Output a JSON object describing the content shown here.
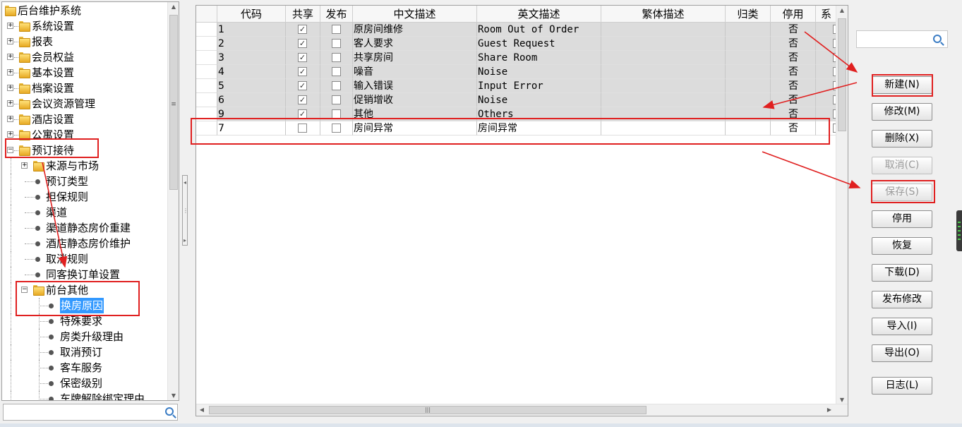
{
  "tree": {
    "items": [
      {
        "label": "后台维护系统",
        "kind": "root"
      },
      {
        "label": "系统设置",
        "kind": "folder",
        "toggle": "+"
      },
      {
        "label": "报表",
        "kind": "folder",
        "toggle": "+"
      },
      {
        "label": "会员权益",
        "kind": "folder",
        "toggle": "+"
      },
      {
        "label": "基本设置",
        "kind": "folder",
        "toggle": "+"
      },
      {
        "label": "档案设置",
        "kind": "folder",
        "toggle": "+"
      },
      {
        "label": "会议资源管理",
        "kind": "folder",
        "toggle": "+"
      },
      {
        "label": "酒店设置",
        "kind": "folder",
        "toggle": "+"
      },
      {
        "label": "公寓设置",
        "kind": "folder",
        "toggle": "+"
      },
      {
        "label": "预订接待",
        "kind": "folder",
        "toggle": "-"
      },
      {
        "label": "来源与市场",
        "kind": "folder",
        "toggle": "+"
      },
      {
        "label": "预订类型",
        "kind": "leaf"
      },
      {
        "label": "担保规则",
        "kind": "leaf"
      },
      {
        "label": "渠道",
        "kind": "leaf"
      },
      {
        "label": "渠道静态房价重建",
        "kind": "leaf"
      },
      {
        "label": "酒店静态房价维护",
        "kind": "leaf"
      },
      {
        "label": "取消规则",
        "kind": "leaf"
      },
      {
        "label": "同客换订单设置",
        "kind": "leaf"
      },
      {
        "label": "前台其他",
        "kind": "folder",
        "toggle": "-"
      },
      {
        "label": "换房原因",
        "kind": "leaf",
        "selected": true
      },
      {
        "label": "特殊要求",
        "kind": "leaf"
      },
      {
        "label": "房类升级理由",
        "kind": "leaf"
      },
      {
        "label": "取消预订",
        "kind": "leaf"
      },
      {
        "label": "客车服务",
        "kind": "leaf"
      },
      {
        "label": "保密级别",
        "kind": "leaf"
      },
      {
        "label": "车牌解除绑定理由",
        "kind": "leaf"
      }
    ],
    "search_value": ""
  },
  "grid": {
    "columns": [
      "代码",
      "共享",
      "发布",
      "中文描述",
      "英文描述",
      "繁体描述",
      "归类",
      "停用",
      "系"
    ],
    "rows": [
      {
        "code": "1",
        "shared": true,
        "published": false,
        "cn": "原房间维修",
        "en": "Room Out of Order",
        "tw": "",
        "category": "",
        "disabled": "否",
        "highlight": true
      },
      {
        "code": "2",
        "shared": true,
        "published": false,
        "cn": "客人要求",
        "en": "Guest Request",
        "tw": "",
        "category": "",
        "disabled": "否",
        "highlight": true
      },
      {
        "code": "3",
        "shared": true,
        "published": false,
        "cn": "共享房间",
        "en": "Share Room",
        "tw": "",
        "category": "",
        "disabled": "否",
        "highlight": true
      },
      {
        "code": "4",
        "shared": true,
        "published": false,
        "cn": "噪音",
        "en": "Noise",
        "tw": "",
        "category": "",
        "disabled": "否",
        "highlight": true
      },
      {
        "code": "5",
        "shared": true,
        "published": false,
        "cn": "输入错误",
        "en": "Input Error",
        "tw": "",
        "category": "",
        "disabled": "否",
        "highlight": true
      },
      {
        "code": "6",
        "shared": true,
        "published": false,
        "cn": "促销增收",
        "en": "Noise",
        "tw": "",
        "category": "",
        "disabled": "否",
        "highlight": true
      },
      {
        "code": "9",
        "shared": true,
        "published": false,
        "cn": "其他",
        "en": "Others",
        "tw": "",
        "category": "",
        "disabled": "否",
        "highlight": true
      },
      {
        "code": "7",
        "shared": false,
        "published": false,
        "cn": "房间异常",
        "en": "房间异常",
        "tw": "",
        "category": "",
        "disabled": "否",
        "highlight": false
      }
    ]
  },
  "right_panel": {
    "search_value": "",
    "buttons": [
      {
        "label": "新建(N)",
        "enabled": true
      },
      {
        "label": "修改(M)",
        "enabled": true
      },
      {
        "label": "删除(X)",
        "enabled": true
      },
      {
        "label": "取消(C)",
        "enabled": false
      },
      {
        "label": "保存(S)",
        "enabled": false
      },
      {
        "label": "停用",
        "enabled": true
      },
      {
        "label": "恢复",
        "enabled": true
      },
      {
        "label": "下载(D)",
        "enabled": true
      },
      {
        "label": "发布修改",
        "enabled": true
      },
      {
        "label": "导入(I)",
        "enabled": true
      },
      {
        "label": "导出(O)",
        "enabled": true
      },
      {
        "label": "日志(L)",
        "enabled": true
      }
    ]
  },
  "colors": {
    "selection": "#3399ff",
    "annotation": "#e02020",
    "row_highlight": "#dcdcdc"
  }
}
